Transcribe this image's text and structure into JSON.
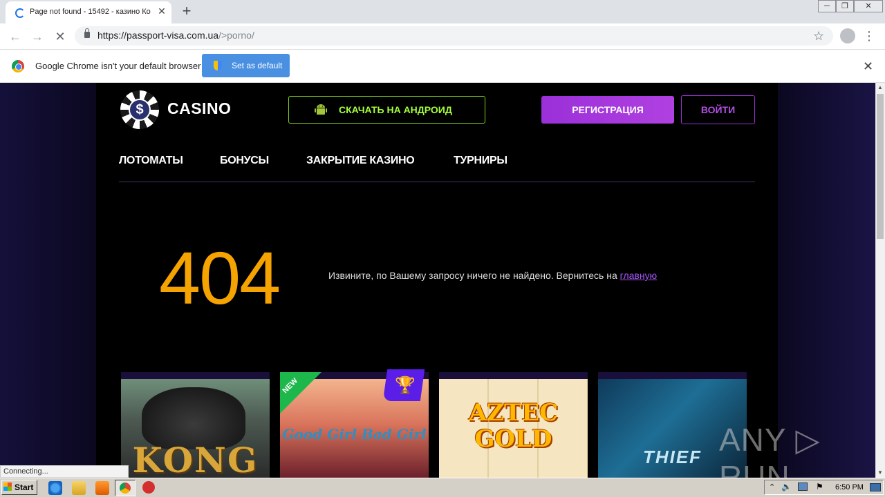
{
  "browser": {
    "tab_title": "Page not found - 15492 - казино Ко",
    "tab_close": "✕",
    "new_tab": "+",
    "url_host": "https://passport-visa.com.ua",
    "url_path": "/>porno/",
    "window_controls": [
      "─",
      "❐",
      "✕"
    ]
  },
  "infobar": {
    "message": "Google Chrome isn't your default browser",
    "set_default_label": "Set as default",
    "close": "✕"
  },
  "site": {
    "logo_symbol": "$",
    "logo_text": "CASINO",
    "android_button": "СКАЧАТЬ НА АНДРОИД",
    "register_button": "РЕГИСТРАЦИЯ",
    "login_button": "ВОЙТИ",
    "nav": [
      "ЛОТОМАТЫ",
      "БОНУСЫ",
      "ЗАКРЫТИЕ КАЗИНО",
      "ТУРНИРЫ"
    ]
  },
  "error": {
    "code": "404",
    "message": "Извините, по Вашему запросу ничего не найдено. Вернитесь на ",
    "link": "главную"
  },
  "games": [
    {
      "title": "KONG"
    },
    {
      "title": "Good Girl Bad Girl",
      "badge": "NEW",
      "trophy": "🏆"
    },
    {
      "title": "AZTEC GOLD"
    },
    {
      "title": "THIEF"
    }
  ],
  "watermark": "ANY ▷ RUN",
  "status_bar": "Connecting...",
  "taskbar": {
    "start": "Start",
    "clock": "6:50 PM"
  },
  "colors": {
    "accent_orange": "#f5a300",
    "accent_purple": "#9b30d9",
    "accent_green": "#7ed321"
  }
}
